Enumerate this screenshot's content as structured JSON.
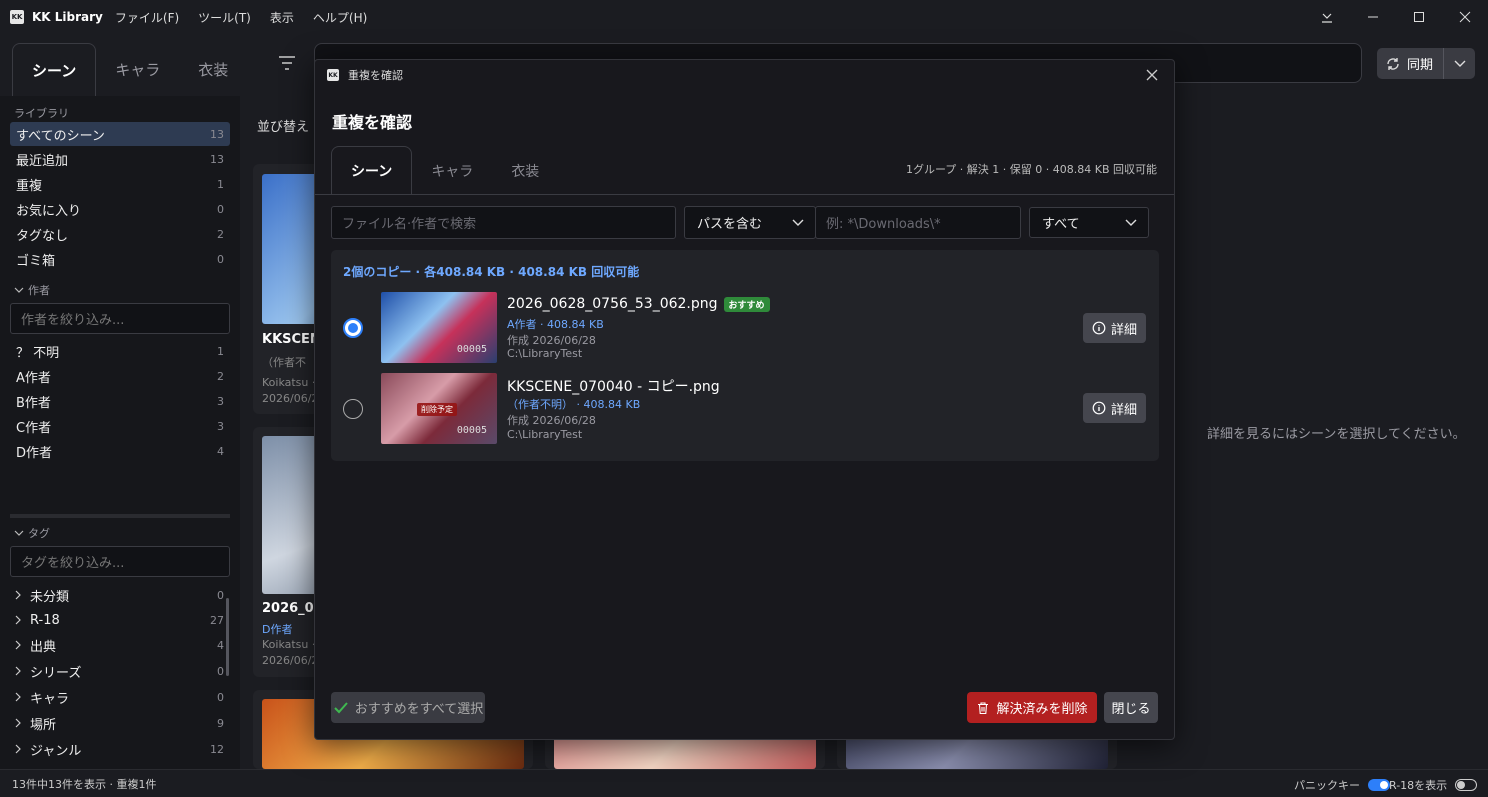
{
  "app": {
    "logo_text": "KK",
    "title": "KK Library",
    "menu": [
      "ファイル(F)",
      "ツール(T)",
      "表示",
      "ヘルプ(H)"
    ]
  },
  "main_tabs": [
    {
      "label": "シーン",
      "active": true
    },
    {
      "label": "キャラ",
      "active": false
    },
    {
      "label": "衣装",
      "active": false
    }
  ],
  "sync": {
    "label": "同期"
  },
  "sidebar": {
    "library_label": "ライブラリ",
    "library_items": [
      {
        "label": "すべてのシーン",
        "count": "13",
        "active": true
      },
      {
        "label": "最近追加",
        "count": "13"
      },
      {
        "label": "重複",
        "count": "1"
      },
      {
        "label": "お気に入り",
        "count": "0"
      },
      {
        "label": "タグなし",
        "count": "2"
      },
      {
        "label": "ゴミ箱",
        "count": "0"
      }
    ],
    "author_label": "作者",
    "author_placeholder": "作者を絞り込み...",
    "authors": [
      {
        "label": "？ 不明",
        "count": "1"
      },
      {
        "label": "A作者",
        "count": "2"
      },
      {
        "label": "B作者",
        "count": "3"
      },
      {
        "label": "C作者",
        "count": "3"
      },
      {
        "label": "D作者",
        "count": "4"
      }
    ],
    "tag_label": "タグ",
    "tag_placeholder": "タグを絞り込み...",
    "tags": [
      {
        "label": "未分類",
        "count": "0"
      },
      {
        "label": "R-18",
        "count": "27"
      },
      {
        "label": "出典",
        "count": "4"
      },
      {
        "label": "シリーズ",
        "count": "0"
      },
      {
        "label": "キャラ",
        "count": "0"
      },
      {
        "label": "場所",
        "count": "9"
      },
      {
        "label": "ジャンル",
        "count": "12"
      }
    ]
  },
  "grid": {
    "sort_label": "並び替え",
    "cards": [
      {
        "title": "KKSCEN",
        "sub1": "（作者不",
        "sub2": "Koikatsu ·",
        "sub3": "2026/06/2"
      },
      {
        "title": "2026_0",
        "author": "D作者",
        "sub2": "Koikatsu ·",
        "sub3": "2026/06/2"
      }
    ]
  },
  "detail_empty": "詳細を見るにはシーンを選択してください。",
  "status": {
    "left": "13件中13件を表示 · 重複1件",
    "panic_label": "パニックキー",
    "panic_on": true,
    "r18_label": "R-18を表示",
    "r18_on": false
  },
  "dialog": {
    "window_title": "重複を確認",
    "title": "重複を確認",
    "tabs": [
      {
        "label": "シーン",
        "active": true
      },
      {
        "label": "キャラ",
        "active": false
      },
      {
        "label": "衣装",
        "active": false
      }
    ],
    "summary": "1グループ · 解決 1 · 保留 0 · 408.84 KB 回収可能",
    "search_placeholder": "ファイル名·作者で検索",
    "path_mode": "パスを含む",
    "path_placeholder": "例: *\\Downloads\\*",
    "scope": "すべて",
    "group": {
      "header": "2個のコピー · 各408.84 KB · 408.84 KB 回収可能",
      "files": [
        {
          "name": "2026_0628_0756_53_062.png",
          "badge": "おすすめ",
          "author": "A作者 · 408.84 KB",
          "created": "作成 2026/06/28",
          "path": "C:\\LibraryTest",
          "selected": true,
          "thumb_number": "00005",
          "detail_label": "詳細"
        },
        {
          "name": "KKSCENE_070040 - コピー.png",
          "author": "（作者不明） · 408.84 KB",
          "created": "作成 2026/06/28",
          "path": "C:\\LibraryTest",
          "selected": false,
          "delete_tag": "削除予定",
          "thumb_number": "00005",
          "detail_label": "詳細"
        }
      ]
    },
    "select_recommended": "おすすめをすべて選択",
    "delete_resolved": "解決済みを削除",
    "close": "閉じる"
  },
  "colors": {
    "accent": "#2d7ff9",
    "author_blue": "#6ea8ff",
    "danger": "#b32020",
    "recommend_green": "#2f8a3a"
  }
}
